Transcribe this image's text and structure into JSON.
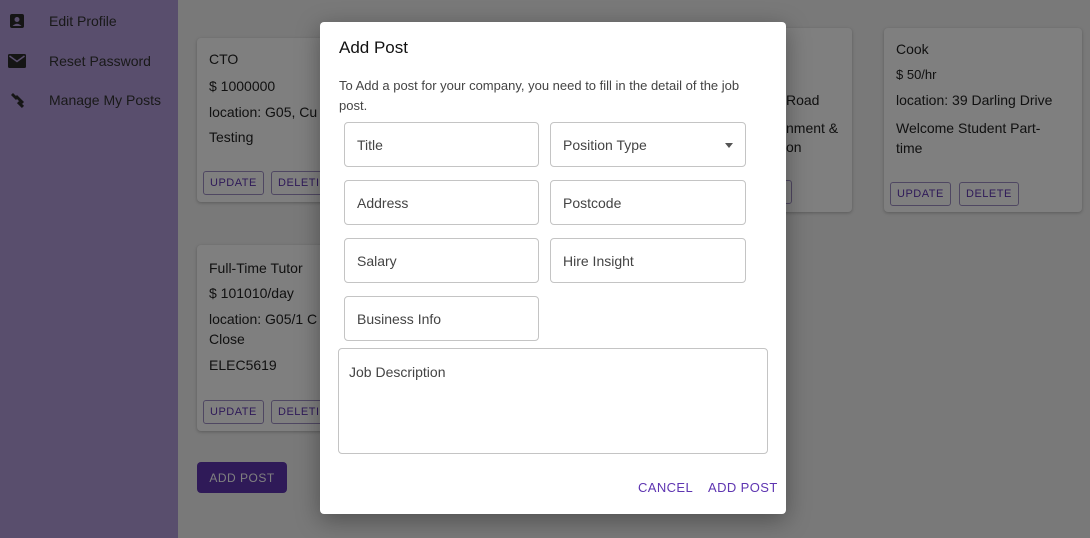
{
  "sidebar": {
    "items": [
      {
        "label": "Edit Profile",
        "icon": "profile-icon"
      },
      {
        "label": "Reset Password",
        "icon": "mail-icon"
      },
      {
        "label": "Manage My Posts",
        "icon": "wrench-icon"
      }
    ]
  },
  "cards": [
    {
      "title": "CTO",
      "salary": "$ 1000000",
      "location": "location: G05, Cu",
      "desc": "Testing",
      "update": "UPDATE",
      "delete": "DELETI"
    },
    {
      "title": "",
      "salary": "",
      "location": "Road",
      "desc": "nment &",
      "desc2": "on"
    },
    {
      "title": "Cook",
      "salary": "$ 50/hr",
      "location": "location: 39 Darling Drive",
      "desc": "Welcome Student Part-time",
      "update": "UPDATE",
      "delete": "DELETE"
    },
    {
      "title": "Full-Time Tutor",
      "salary": "$ 101010/day",
      "location": "location: G05/1 C Close",
      "desc": "ELEC5619",
      "update": "UPDATE",
      "delete": "DELETI"
    }
  ],
  "main": {
    "add_post_button": "ADD POST"
  },
  "dialog": {
    "title": "Add Post",
    "description": "To Add a post for your company, you need to fill in the detail of the job post.",
    "fields": {
      "title": "Title",
      "position_type": "Position Type",
      "address": "Address",
      "postcode": "Postcode",
      "salary": "Salary",
      "hire_insight": "Hire Insight",
      "business_info": "Business Info",
      "job_description": "Job Description"
    },
    "cancel": "CANCEL",
    "add_post": "ADD POST"
  },
  "colors": {
    "accent": "#5e35b1",
    "sidebar": "#b39ddb"
  }
}
